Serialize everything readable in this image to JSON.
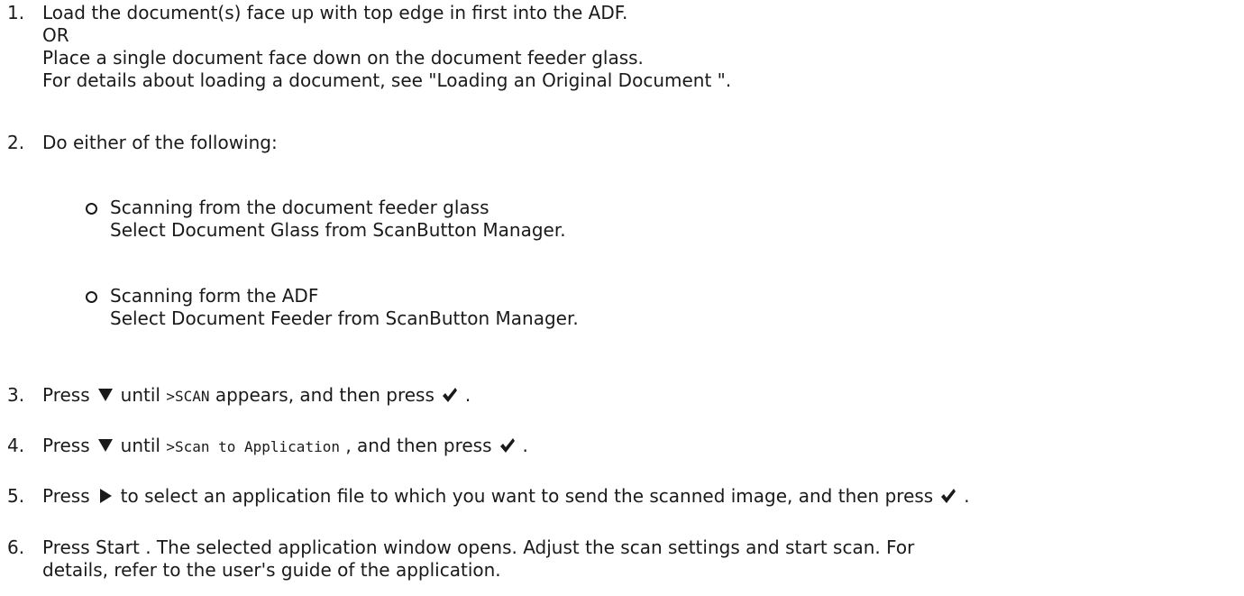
{
  "steps": [
    {
      "num": "1.",
      "lines": [
        "Load the document(s) face up with top edge in first into the ADF.",
        "OR",
        "Place a single document face down on the document feeder glass.",
        "For details about loading a document, see \"Loading an Original Document \"."
      ]
    },
    {
      "num": "2.",
      "intro": "Do either of the following:",
      "options": [
        {
          "title": "Scanning from the document feeder glass",
          "detail": "Select Document Glass from ScanButton Manager."
        },
        {
          "title": "Scanning form the ADF",
          "detail": "Select Document Feeder from ScanButton Manager."
        }
      ]
    },
    {
      "num": "3.",
      "press": "Press",
      "mid_a": "until",
      "code": ">SCAN",
      "mid_b": "appears, and then press",
      "end": "."
    },
    {
      "num": "4.",
      "press": "Press",
      "mid_a": "until",
      "code": ">Scan to Application",
      "mid_b": ", and then press",
      "end": "."
    },
    {
      "num": "5.",
      "press": "Press",
      "mid_b": "to select an application file to which you want to send the scanned image, and then press",
      "end": "."
    },
    {
      "num": "6.",
      "lines": [
        "Press Start . The selected application window opens. Adjust the scan settings and start scan. For",
        "details, refer to the user's guide of the application."
      ]
    }
  ],
  "icons": {
    "down": "down-arrow-icon",
    "ok": "checkmark-icon",
    "right": "right-arrow-icon"
  }
}
